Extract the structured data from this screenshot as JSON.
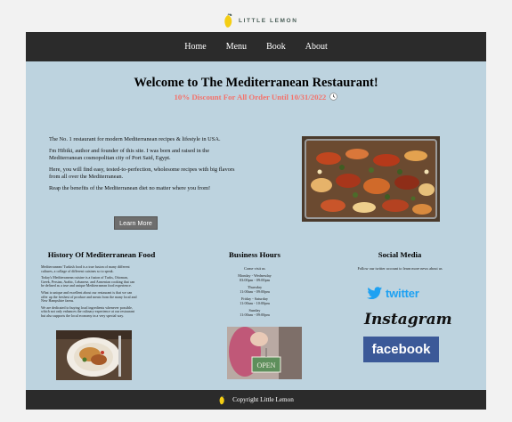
{
  "brand": {
    "name": "LITTLE LEMON"
  },
  "nav": {
    "items": [
      "Home",
      "Menu",
      "Book",
      "About"
    ]
  },
  "hero": {
    "title": "Welcome to The Mediterranean Restaurant!",
    "discount": "10% Discount For All Order Until 10/31/2022",
    "paragraphs": [
      "The No. 1 restaurant for modern Mediterranean recipes & lifestyle in USA.",
      "I'm Hibiki, author and founder of this site. I was born and raised in the Mediterranean cosmopolitan city of Port Said, Egypt.",
      "Here, you will find easy, tested-to-perfection, wholesome recipes with big flavors from all over the Mediterranean.",
      "Reap the benefits of the Mediterranean diet no matter where you from!"
    ],
    "button": "Learn More"
  },
  "history": {
    "title": "History Of Mediterranean Food",
    "paragraphs": [
      "Mediterranean/ Turkish food is a true fusion of many different cultures, a collage of different cuisines so to speak.",
      "Today's Mediterranean cuisine is a fusion of Turks, Ottoman, Greek, Persian, Arabic, Lebanese, and Armenian cooking that can be defined as a true and unique Mediterranean food experience.",
      "What is unique and excellent about our restaurant is that we can offer up the freshest of produce and meats from the many local and New Hampshire farms.",
      "We are dedicated to buying local ingredients whenever possible, which not only enhances the culinary experience at our restaurant but also supports the local economy in a very special way."
    ]
  },
  "hours": {
    "title": "Business Hours",
    "intro": "Come visit us",
    "schedule": [
      {
        "days": "Monday - Wednesday",
        "time": "03:00pm - 09:00pm"
      },
      {
        "days": "Thursday",
        "time": "11:00am - 09:00pm"
      },
      {
        "days": "Friday - Saturday",
        "time": "11:00am - 10:00pm"
      },
      {
        "days": "Sunday",
        "time": "11:00am - 09:00pm"
      }
    ],
    "sign_text": "OPEN"
  },
  "social": {
    "title": "Social Media",
    "subtitle": "Follow our twitter account to learn more news about us",
    "twitter": "twitter",
    "instagram": "Instagram",
    "facebook": "facebook"
  },
  "footer": {
    "text": "Copyright Little Lemon"
  },
  "colors": {
    "nav_bg": "#2b2b2b",
    "main_bg": "#bdd3df",
    "discount": "#f4726b",
    "twitter": "#1da1f2",
    "facebook": "#3b5998"
  }
}
